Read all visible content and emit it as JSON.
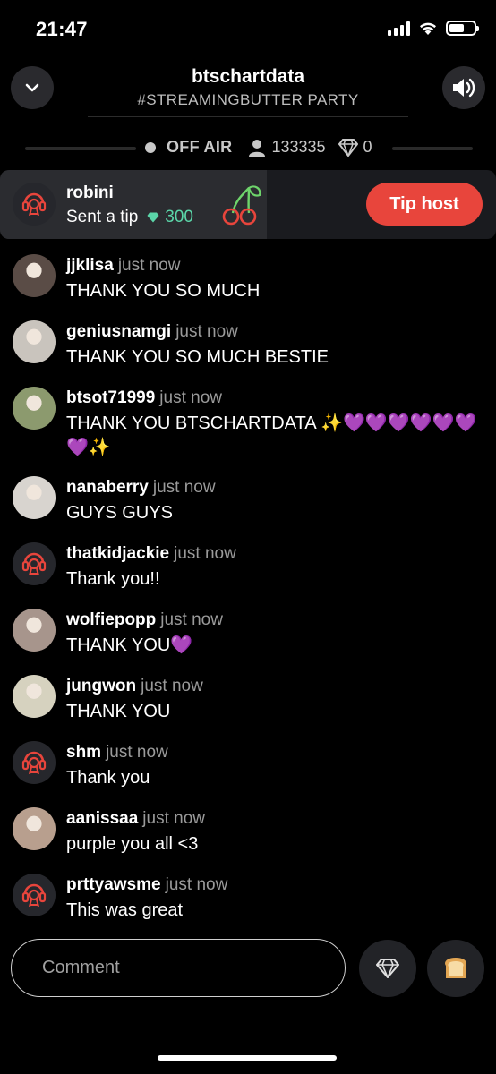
{
  "status_bar": {
    "time": "21:47"
  },
  "header": {
    "title": "btschartdata",
    "subtitle": "#STREAMINGBUTTER PARTY"
  },
  "stats": {
    "status": "OFF AIR",
    "listeners": "133335",
    "gems": "0"
  },
  "tip_banner": {
    "user": "robini",
    "action": "Sent a tip",
    "amount": "300",
    "button_label": "Tip host"
  },
  "messages": [
    {
      "user": "jjklisa",
      "time": "just now",
      "text": "THANK YOU SO MUCH",
      "avatar": "photo-avatar",
      "avatar_color": "#5a4c46"
    },
    {
      "user": "geniusnamgi",
      "time": "just now",
      "text": "THANK YOU SO MUCH BESTIE",
      "avatar": "photo-avatar",
      "avatar_color": "#c9c4bd"
    },
    {
      "user": "btsot71999",
      "time": "just now",
      "text": "THANK YOU BTSCHARTDATA ✨💜💜💜💜💜💜💜✨",
      "avatar": "photo-avatar",
      "avatar_color": "#8c9a6e"
    },
    {
      "user": "nanaberry",
      "time": "just now",
      "text": "GUYS GUYS",
      "avatar": "photo-avatar",
      "avatar_color": "#d8d4cf"
    },
    {
      "user": "thatkidjackie",
      "time": "just now",
      "text": "Thank you!!",
      "avatar": "app-avatar",
      "avatar_color": "#26272c"
    },
    {
      "user": "wolfiepopp",
      "time": "just now",
      "text": "THANK YOU💜",
      "avatar": "photo-avatar",
      "avatar_color": "#a7958c"
    },
    {
      "user": "jungwon",
      "time": "just now",
      "text": "THANK YOU",
      "avatar": "photo-avatar",
      "avatar_color": "#d6d2bf"
    },
    {
      "user": "shm",
      "time": "just now",
      "text": "Thank you",
      "avatar": "app-avatar",
      "avatar_color": "#26272c"
    },
    {
      "user": "aanissaa",
      "time": "just now",
      "text": "purple you all <3",
      "avatar": "photo-avatar",
      "avatar_color": "#b89f8e"
    },
    {
      "user": "prttyawsme",
      "time": "just now",
      "text": "This was great",
      "avatar": "app-avatar",
      "avatar_color": "#26272c"
    }
  ],
  "composer": {
    "placeholder": "Comment"
  },
  "colors": {
    "accent_red": "#e8453c",
    "gem_green": "#5bd6a9",
    "heart_purple": "#9b4de0"
  }
}
